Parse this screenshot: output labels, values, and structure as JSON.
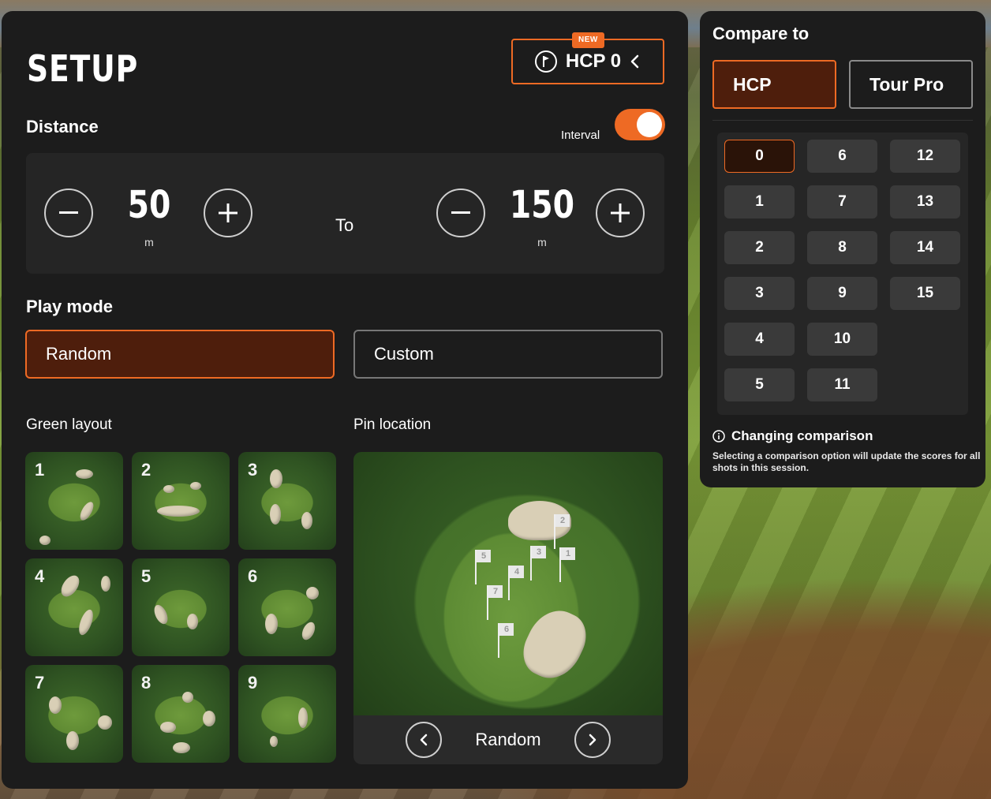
{
  "setup": {
    "title": "SETUP",
    "hcp_button": {
      "badge": "NEW",
      "label": "HCP 0"
    },
    "distance": {
      "label": "Distance",
      "interval_label": "Interval",
      "interval_on": true,
      "from_value": "50",
      "from_unit": "m",
      "to_label": "To",
      "to_value": "150",
      "to_unit": "m"
    },
    "play_mode": {
      "label": "Play mode",
      "options": [
        "Random",
        "Custom"
      ],
      "selected": "Random"
    },
    "green_layout": {
      "label": "Green layout",
      "tiles": [
        "1",
        "2",
        "3",
        "4",
        "5",
        "6",
        "7",
        "8",
        "9"
      ]
    },
    "pin_location": {
      "label": "Pin location",
      "pins": [
        "1",
        "2",
        "3",
        "4",
        "5",
        "6",
        "7"
      ],
      "current": "Random"
    }
  },
  "compare": {
    "title": "Compare to",
    "options": [
      "HCP",
      "Tour Pro"
    ],
    "selected": "HCP",
    "hcp_values": [
      "0",
      "1",
      "2",
      "3",
      "4",
      "5",
      "6",
      "7",
      "8",
      "9",
      "10",
      "11",
      "12",
      "13",
      "14",
      "15"
    ],
    "selected_hcp": "0",
    "note_title": "Changing comparison",
    "note_text": "Selecting a comparison option will update the scores for all shots in this session."
  },
  "colors": {
    "accent": "#ee6a24",
    "panel": "#1c1c1c",
    "selected_fill": "#4e1e0c"
  },
  "icons": {
    "hcp_button": [
      "flag-circle-icon",
      "chevron-left-icon"
    ],
    "steppers": [
      "minus-icon",
      "plus-icon"
    ],
    "pin_nav": [
      "chevron-left-icon",
      "chevron-right-icon"
    ],
    "note": "info-icon"
  }
}
